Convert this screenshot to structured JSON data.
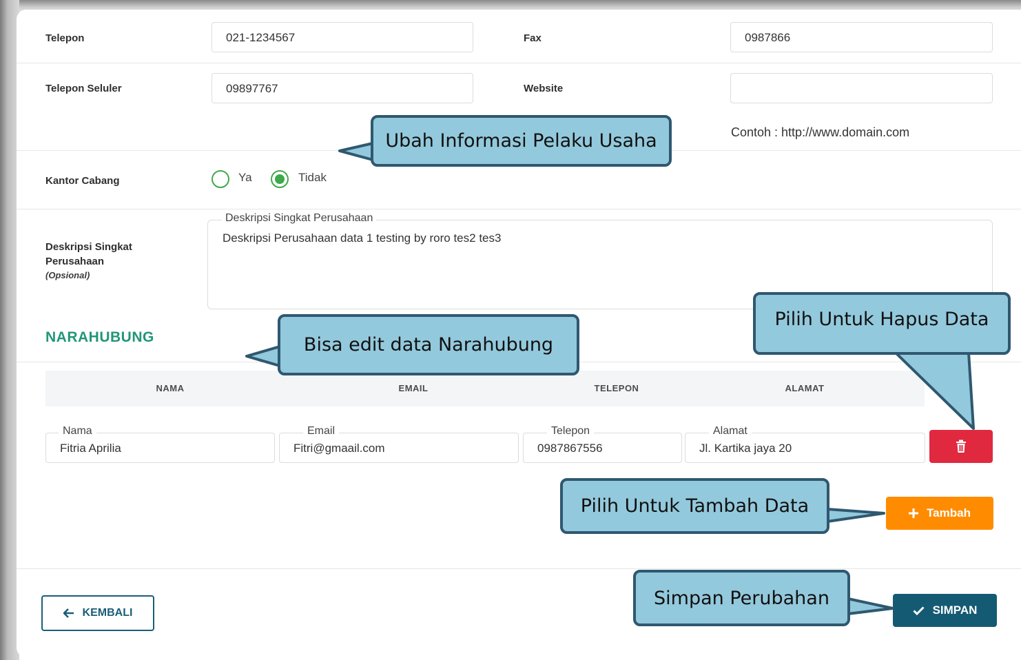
{
  "form": {
    "telepon": {
      "label": "Telepon",
      "value": "021-1234567"
    },
    "fax": {
      "label": "Fax",
      "value": "0987866"
    },
    "telepon_seluler": {
      "label": "Telepon Seluler",
      "value": "09897767"
    },
    "website": {
      "label": "Website",
      "value": "",
      "hint": "Contoh : http://www.domain.com"
    },
    "kantor_cabang": {
      "label": "Kantor Cabang",
      "options": [
        "Ya",
        "Tidak"
      ],
      "selected": "Tidak"
    },
    "deskripsi": {
      "label": "Deskripsi Singkat Perusahaan",
      "optional": "(Opsional)",
      "legend": "Deskripsi Singkat Perusahaan",
      "value": "Deskripsi Perusahaan data 1 testing by roro tes2 tes3"
    }
  },
  "narahubung": {
    "title": "NARAHUBUNG",
    "columns": [
      "NAMA",
      "EMAIL",
      "TELEPON",
      "ALAMAT"
    ],
    "row": {
      "nama_label": "Nama",
      "nama": "Fitria Aprilia",
      "email_label": "Email",
      "email": "Fitri@gmaail.com",
      "telepon_label": "Telepon",
      "telepon": "0987867556",
      "alamat_label": "Alamat",
      "alamat": "Jl. Kartika jaya 20"
    },
    "tambah_label": "Tambah"
  },
  "footer": {
    "back_label": "KEMBALI",
    "save_label": "SIMPAN"
  },
  "callouts": {
    "ubah": "Ubah Informasi Pelaku Usaha",
    "edit": "Bisa edit data Narahubung",
    "hapus": "Pilih Untuk Hapus Data",
    "tambah": "Pilih Untuk Tambah Data",
    "simpan": "Simpan Perubahan"
  },
  "colors": {
    "accent_green": "#229678",
    "delete_red": "#e0293f",
    "add_orange": "#ff8c00",
    "primary_teal": "#155a73",
    "callout_fill": "#93c9dc"
  },
  "icons": [
    "trash-icon",
    "plus-icon",
    "arrow-left-icon",
    "check-icon"
  ]
}
